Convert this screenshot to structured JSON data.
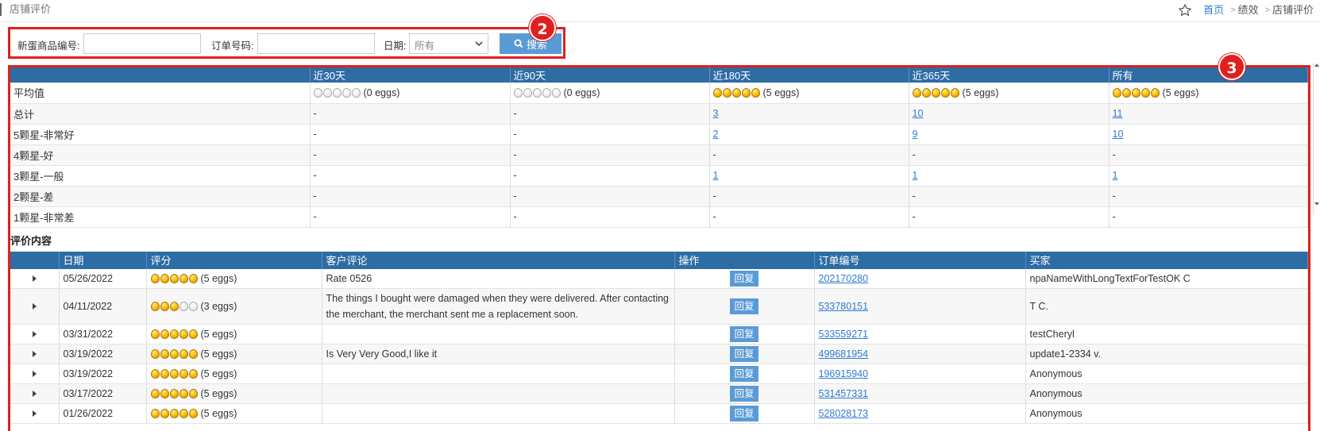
{
  "header": {
    "title": "店铺评价",
    "breadcrumb": [
      {
        "label": "首页",
        "link": true
      },
      {
        "label": "绩效",
        "link": false
      },
      {
        "label": "店铺评价",
        "link": false
      }
    ]
  },
  "search": {
    "product_label": "新蛋商品编号:",
    "product_value": "",
    "order_label": "订单号码:",
    "order_value": "",
    "date_label": "日期:",
    "date_selected": "所有",
    "search_button": "搜索"
  },
  "annotations": {
    "search_badge": "2",
    "table_badge": "3"
  },
  "summary": {
    "columns": [
      "",
      "近30天",
      "近90天",
      "近180天",
      "近365天",
      "所有"
    ],
    "rows": [
      {
        "label": "平均值",
        "type": "eggs",
        "cells": [
          {
            "eggs": 0,
            "text": "(0 eggs)"
          },
          {
            "eggs": 0,
            "text": "(0 eggs)"
          },
          {
            "eggs": 5,
            "text": "(5 eggs)"
          },
          {
            "eggs": 5,
            "text": "(5 eggs)"
          },
          {
            "eggs": 5,
            "text": "(5 eggs)"
          }
        ]
      },
      {
        "label": "总计",
        "cells": [
          "-",
          "-",
          "3",
          "10",
          "11"
        ]
      },
      {
        "label": "5颗星-非常好",
        "cells": [
          "-",
          "-",
          "2",
          "9",
          "10"
        ]
      },
      {
        "label": "4颗星-好",
        "cells": [
          "-",
          "-",
          "-",
          "-",
          "-"
        ]
      },
      {
        "label": "3颗星-一般",
        "cells": [
          "-",
          "-",
          "1",
          "1",
          "1"
        ]
      },
      {
        "label": "2颗星-差",
        "cells": [
          "-",
          "-",
          "-",
          "-",
          "-"
        ]
      },
      {
        "label": "1颗星-非常差",
        "cells": [
          "-",
          "-",
          "-",
          "-",
          "-"
        ]
      }
    ]
  },
  "reviews": {
    "section_title": "评价内容",
    "columns": [
      "",
      "日期",
      "评分",
      "客户评论",
      "操作",
      "订单编号",
      "买家"
    ],
    "reply_label": "回复",
    "rows": [
      {
        "date": "05/26/2022",
        "eggs": 5,
        "eggs_text": "(5 eggs)",
        "comment": "Rate 0526",
        "order": "202170280",
        "buyer": "npaNameWithLongTextForTestOK C"
      },
      {
        "date": "04/11/2022",
        "eggs": 3,
        "eggs_text": "(3 eggs)",
        "comment": "The things I bought were damaged when they were delivered. After contacting the merchant, the merchant sent me a replacement soon.",
        "order": "533780151",
        "buyer": "T C."
      },
      {
        "date": "03/31/2022",
        "eggs": 5,
        "eggs_text": "(5 eggs)",
        "comment": "",
        "order": "533559271",
        "buyer": "testCheryl"
      },
      {
        "date": "03/19/2022",
        "eggs": 5,
        "eggs_text": "(5 eggs)",
        "comment": "Is Very Very Good,I like it",
        "order": "499681954",
        "buyer": "update1-2334 v."
      },
      {
        "date": "03/19/2022",
        "eggs": 5,
        "eggs_text": "(5 eggs)",
        "comment": "",
        "order": "196915940",
        "buyer": "Anonymous"
      },
      {
        "date": "03/17/2022",
        "eggs": 5,
        "eggs_text": "(5 eggs)",
        "comment": "",
        "order": "531457331",
        "buyer": "Anonymous"
      },
      {
        "date": "01/26/2022",
        "eggs": 5,
        "eggs_text": "(5 eggs)",
        "comment": "",
        "order": "528028173",
        "buyer": "Anonymous"
      }
    ]
  },
  "colors": {
    "header_blue": "#2e6da4",
    "button_blue": "#5b9bd5",
    "highlight_red": "#e0201e",
    "link": "#2f7bd1"
  }
}
